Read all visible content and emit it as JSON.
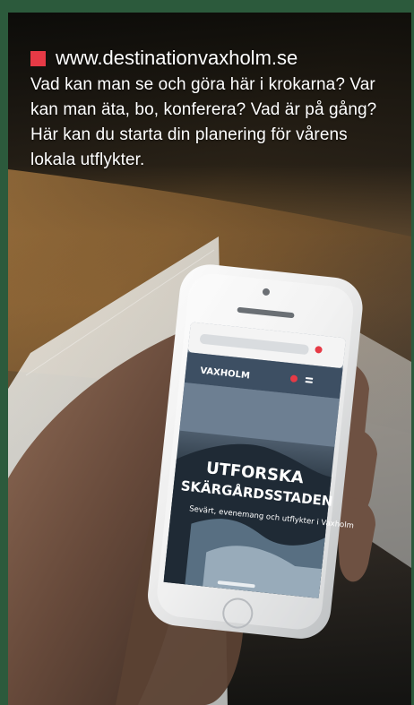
{
  "article": {
    "url": "www.destinationvaxholm.se",
    "description": "Vad kan man se och göra här i krokarna? Var kan man äta, bo, konferera? Vad är på gång? Här kan du starta din planering för vårens lokala utflykter."
  },
  "phone_screen": {
    "site_logo": "VAXHOLM",
    "headline_line1": "UTFORSKA",
    "headline_line2": "SKÄRGÅRDSSTADEN",
    "subtext": "Sevärt, evenemang och utflykter i Vaxholm"
  },
  "colors": {
    "accent_bullet": "#e63a46",
    "frame_green": "#2c5a3c"
  }
}
